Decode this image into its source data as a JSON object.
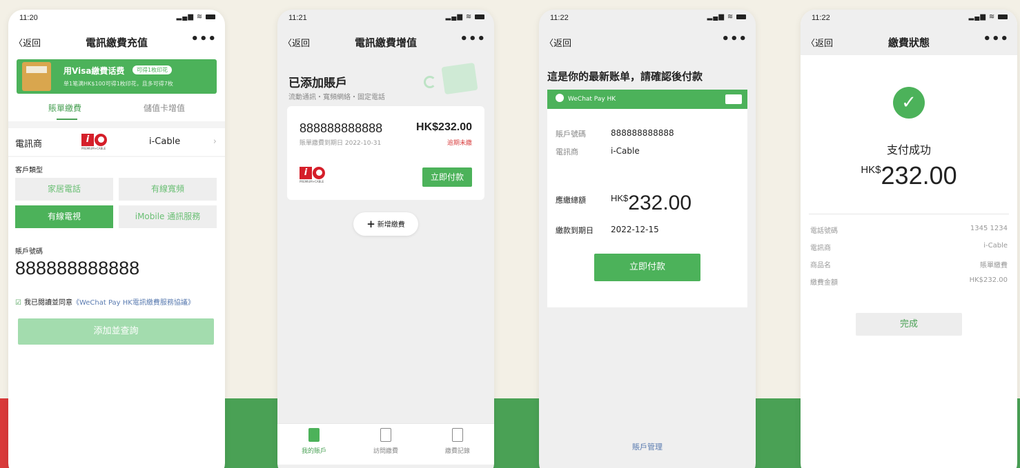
{
  "phones": [
    {
      "time": "11:20",
      "back": "〈返回",
      "title": "電訊繳費充值",
      "more": "•••",
      "banner": {
        "title": "用Visa繳費话费",
        "pill": "可得1枚印花",
        "sub": "单1笔满HK$100可得1枚印花，且多可得7枚"
      },
      "tabs": [
        "賬單繳費",
        "儲值卡增值"
      ],
      "carrier_label": "電訊商",
      "carrier_value": "i-Cable",
      "customer_type_label": "客戶類型",
      "options": [
        "家居電話",
        "有線寬頻",
        "有線電視",
        "iMobile 通訊服務"
      ],
      "selected_option": "有線電視",
      "account_label": "賬戶號碼",
      "account_value": "888888888888",
      "agree_text": "我已閱讀並同意",
      "agree_link": "《WeChat Pay HK電訊繳費服務協議》",
      "add_button": "添加並查詢"
    },
    {
      "time": "11:21",
      "back": "〈返回",
      "title": "電訊繳費增值",
      "more": "•••",
      "heading": "已添加賬戶",
      "subheading": "流動通訊・寬頻網絡・固定電話",
      "card": {
        "account": "888888888888",
        "amount": "HK$232.00",
        "due": "賬單繳費到期日 2022-10-31",
        "status": "逾期未繳",
        "pay_button": "立即付款"
      },
      "add_bill": "新增繳費",
      "tabbar": [
        "我的賬戶",
        "訪問繳費",
        "繳費記錄"
      ]
    },
    {
      "time": "11:22",
      "back": "〈返回",
      "more": "•••",
      "heading": "這是你的最新账单，請確認後付款",
      "brand": "WeChat Pay HK",
      "rows": [
        {
          "k": "賬戶號碼",
          "v": "888888888888"
        },
        {
          "k": "電訊商",
          "v": "i-Cable"
        }
      ],
      "due_label": "應繳總額",
      "currency": "HK$",
      "amount": "232.00",
      "date_label": "繳款到期日",
      "date_value": "2022-12-15",
      "pay_button": "立即付款",
      "footer_link": "賬戶管理"
    },
    {
      "time": "11:22",
      "back": "〈返回",
      "title": "繳費狀態",
      "more": "•••",
      "success": "支付成功",
      "currency": "HK$",
      "amount": "232.00",
      "rows": [
        {
          "k": "電話號碼",
          "v": "1345 1234"
        },
        {
          "k": "電訊商",
          "v": "i-Cable"
        },
        {
          "k": "商品名",
          "v": "賬單繳費"
        },
        {
          "k": "繳費金額",
          "v": "HK$232.00"
        }
      ],
      "done_button": "完成"
    }
  ],
  "colors": {
    "brand_green": "#4cb25a",
    "bg": "#f3f0e6",
    "band_red": "#d93a3a"
  },
  "icons": [
    "check-icon",
    "plus-icon",
    "wechat-icon",
    "i-cable-logo"
  ]
}
